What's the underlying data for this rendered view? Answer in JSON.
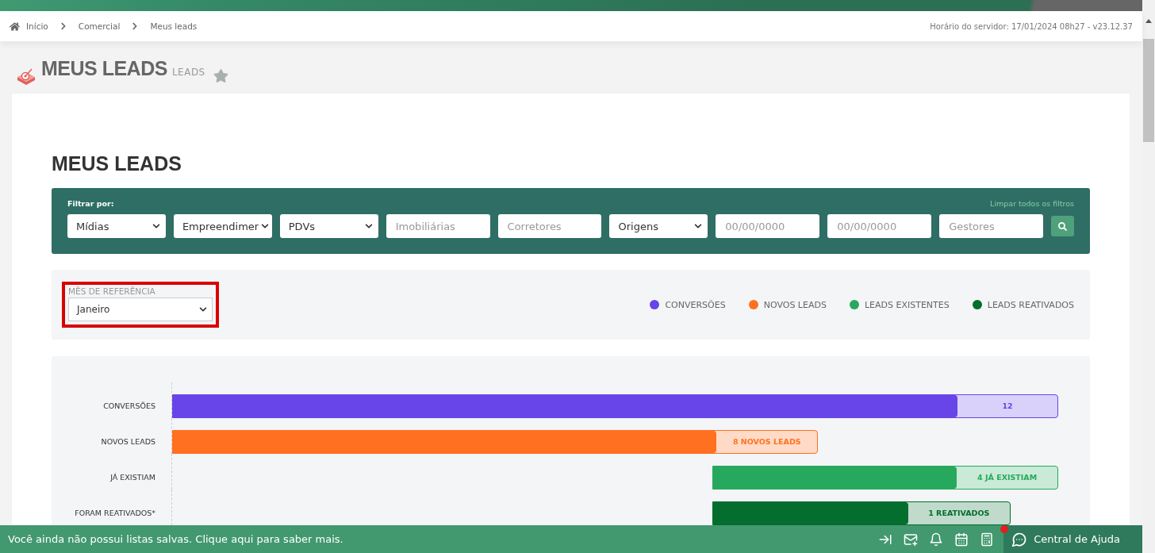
{
  "breadcrumb": [
    "Início",
    "Comercial",
    "Meus leads"
  ],
  "server_info": "Horário do servidor: 17/01/2024 08h27 - v23.12.37",
  "page_title": "MEUS LEADS",
  "page_subtitle": "LEADS",
  "favorite": false,
  "section_title": "MEUS LEADS",
  "filters": {
    "label": "Filtrar por:",
    "clear_link": "Limpar todos os filtros",
    "fields": [
      {
        "kind": "select",
        "value": "Mídias"
      },
      {
        "kind": "select",
        "value": "Empreendimer"
      },
      {
        "kind": "select",
        "value": "PDVs"
      },
      {
        "kind": "input",
        "placeholder": "Imobiliárias"
      },
      {
        "kind": "input",
        "placeholder": "Corretores"
      },
      {
        "kind": "select",
        "value": "Origens"
      },
      {
        "kind": "input",
        "placeholder": "00/00/0000"
      },
      {
        "kind": "input",
        "placeholder": "00/00/0000"
      },
      {
        "kind": "input",
        "placeholder": "Gestores"
      }
    ]
  },
  "reference_month": {
    "label": "MÊS DE REFERÊNCIA",
    "value": "Janeiro",
    "highlighted": true
  },
  "legend": [
    {
      "label": "CONVERSÕES",
      "color": "#6745e8"
    },
    {
      "label": "NOVOS LEADS",
      "color": "#ff7020"
    },
    {
      "label": "LEADS EXISTENTES",
      "color": "#27a95d"
    },
    {
      "label": "LEADS REATIVADOS",
      "color": "#036e2e"
    }
  ],
  "funnel": [
    {
      "label": "CONVERSÕES",
      "value": "12",
      "color": "#6745e8"
    },
    {
      "label": "NOVOS LEADS",
      "value": "8 NOVOS LEADS",
      "color": "#ff7020"
    },
    {
      "label": "JÁ EXISTIAM",
      "value": "4 JÁ EXISTIAM",
      "color": "#27a95d"
    },
    {
      "label": "FORAM REATIVADOS*",
      "value": "1 REATIVADOS",
      "color": "#036e2e"
    }
  ],
  "footer": {
    "message": "Você ainda não possui listas salvas. Clique aqui para saber mais.",
    "help": "Central de Ajuda",
    "help_alert": true
  }
}
